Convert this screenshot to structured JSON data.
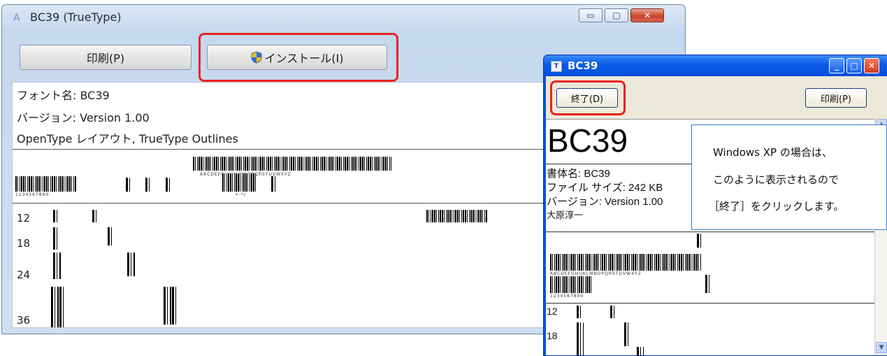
{
  "win7": {
    "title": "BC39 (TrueType)",
    "buttons": {
      "print": "印刷(P)",
      "install": "インストール(I)"
    },
    "caption": {
      "minimize": "▭",
      "maximize": "▢",
      "close": "✕"
    },
    "info": {
      "font_name": "フォント名: BC39",
      "version": "バージョン: Version 1.00",
      "layout": "OpenType レイアウト, TrueType Outlines"
    },
    "sample_alpha": "ABCDEFGHIJKLMNOPQRSTUVWXYZ",
    "sample_digits": "1234567890",
    "sample_symbols": "+-*/",
    "sizes": [
      "12",
      "18",
      "24",
      "36"
    ]
  },
  "xp": {
    "title": "BC39",
    "buttons": {
      "exit": "終了(D)",
      "print": "印刷(P)"
    },
    "caption": {
      "minimize": "_",
      "maximize": "□",
      "close": "✕"
    },
    "big_name": "BC39",
    "info": {
      "typeface": "書体名: BC39",
      "filesize": "ファイル サイズ: 242 KB",
      "version": "バージョン: Version 1.00",
      "author": "大原淳一"
    },
    "sample_alpha": "ABCDEFGHIJKLMNOPQRSTUVWXYZ",
    "sample_digits": "1234567890",
    "sizes": [
      "12",
      "18"
    ]
  },
  "callout": {
    "line1": "Windows XP の場合は、",
    "line2": "このように表示されるので",
    "line3": "［終了］をクリックします。"
  },
  "colors": {
    "highlight": "#e8221e",
    "xp_title": "#0a5ae6",
    "win7_frame": "#c4d8ee"
  }
}
